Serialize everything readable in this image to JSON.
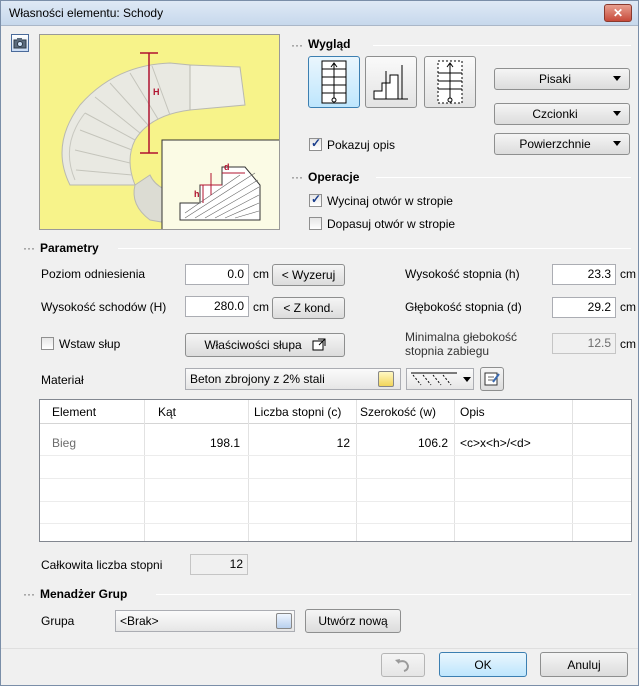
{
  "window": {
    "title": "Własności elementu: Schody",
    "close_glyph": "✕"
  },
  "preview": {
    "label_H": "H",
    "label_h": "h",
    "label_d": "d"
  },
  "wyglad": {
    "section": "Wygląd",
    "buttons": {
      "pisaki": "Pisaki",
      "czcionki": "Czcionki",
      "powierzchnie": "Powierzchnie"
    },
    "show_desc_label": "Pokazuj opis",
    "show_desc_checked": true
  },
  "operacje": {
    "section": "Operacje",
    "cut_hole_label": "Wycinaj otwór w stropie",
    "cut_hole_checked": true,
    "fit_hole_label": "Dopasuj otwór w stropie",
    "fit_hole_checked": false
  },
  "parametry": {
    "section": "Parametry",
    "poziom": {
      "label": "Poziom odniesienia",
      "value": "0.0",
      "unit": "cm",
      "button": "< Wyzeruj"
    },
    "wys_schodow": {
      "label": "Wysokość schodów (H)",
      "value": "280.0",
      "unit": "cm",
      "button": "< Z kond."
    },
    "wstaw_slup": {
      "label": "Wstaw słup",
      "checked": false
    },
    "wlasciwosci_slupa": "Właściwości słupa",
    "wys_stopnia": {
      "label": "Wysokość stopnia (h)",
      "value": "23.3",
      "unit": "cm"
    },
    "gleb_stopnia": {
      "label": "Głębokość stopnia (d)",
      "value": "29.2",
      "unit": "cm"
    },
    "min_gleb": {
      "label_line1": "Minimalna głebokość",
      "label_line2": "stopnia zabiegu",
      "value": "12.5",
      "unit": "cm"
    },
    "material": {
      "label": "Materiał",
      "value": "Beton zbrojony z 2% stali"
    }
  },
  "table": {
    "columns": [
      "Element",
      "Kąt",
      "Liczba stopni (c)",
      "Szerokość (w)",
      "Opis"
    ],
    "rows": [
      {
        "element": "Bieg",
        "kat": "198.1",
        "liczba": "12",
        "szerokosc": "106.2",
        "opis": "<c>x<h>/<d>"
      }
    ]
  },
  "total": {
    "label": "Całkowita liczba stopni",
    "value": "12"
  },
  "menadzer": {
    "section": "Menadżer Grup",
    "grupa_label": "Grupa",
    "grupa_value": "<Brak>",
    "create_button": "Utwórz nową"
  },
  "footer": {
    "ok": "OK",
    "cancel": "Anuluj"
  },
  "colors": {
    "preview_bg": "#f7f38a",
    "dim_red": "#b0132f",
    "accent_blue": "#3c7fb1"
  }
}
